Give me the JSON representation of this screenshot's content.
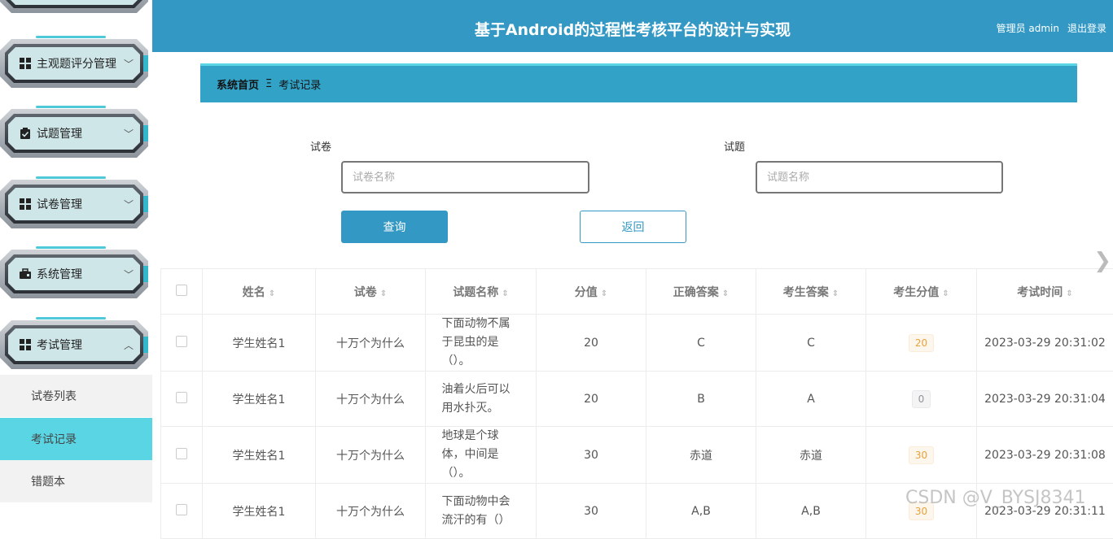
{
  "header": {
    "title": "基于Android的过程性考核平台的设计与实现",
    "user": "管理员 admin",
    "logout": "退出登录"
  },
  "sidebar": {
    "items": [
      {
        "label": "主观题评分管理",
        "icon": "grid-icon",
        "chevron": "﹀"
      },
      {
        "label": "试题管理",
        "icon": "clipboard-check-icon",
        "chevron": "﹀"
      },
      {
        "label": "试卷管理",
        "icon": "grid-icon",
        "chevron": "﹀"
      },
      {
        "label": "系统管理",
        "icon": "briefcase-icon",
        "chevron": "﹀"
      },
      {
        "label": "考试管理",
        "icon": "grid-icon",
        "chevron": "︿"
      }
    ],
    "subitems": [
      {
        "label": "试卷列表"
      },
      {
        "label": "考试记录"
      },
      {
        "label": "错题本"
      }
    ]
  },
  "breadcrumb": {
    "home": "系统首页",
    "separator": "Ξ",
    "current": "考试记录"
  },
  "search": {
    "paper_label": "试卷",
    "paper_placeholder": "试卷名称",
    "question_label": "试题",
    "question_placeholder": "试题名称",
    "query_button": "查询",
    "back_button": "返回"
  },
  "table": {
    "headers": [
      "姓名",
      "试卷",
      "试题名称",
      "分值",
      "正确答案",
      "考生答案",
      "考生分值",
      "考试时间"
    ],
    "sort_icon": "⇕",
    "rows": [
      {
        "name": "学生姓名1",
        "paper": "十万个为什么",
        "question": "下面动物不属于昆虫的是（）。",
        "points": "20",
        "correct": "C",
        "answer": "C",
        "score": "20",
        "time": "2023-03-29 20:31:02"
      },
      {
        "name": "学生姓名1",
        "paper": "十万个为什么",
        "question": "油着火后可以用水扑灭。",
        "points": "20",
        "correct": "B",
        "answer": "A",
        "score": "0",
        "time": "2023-03-29 20:31:04"
      },
      {
        "name": "学生姓名1",
        "paper": "十万个为什么",
        "question": "地球是个球体，中间是（）。",
        "points": "30",
        "correct": "赤道",
        "answer": "赤道",
        "score": "30",
        "time": "2023-03-29 20:31:08"
      },
      {
        "name": "学生姓名1",
        "paper": "十万个为什么",
        "question": "下面动物中会流汗的有（）",
        "points": "30",
        "correct": "A,B",
        "answer": "A,B",
        "score": "30",
        "time": "2023-03-29 20:31:11"
      }
    ]
  },
  "watermark": "CSDN @V_BYSJ8341",
  "colors": {
    "primary": "#3399c4",
    "accent": "#5ad5e3"
  }
}
